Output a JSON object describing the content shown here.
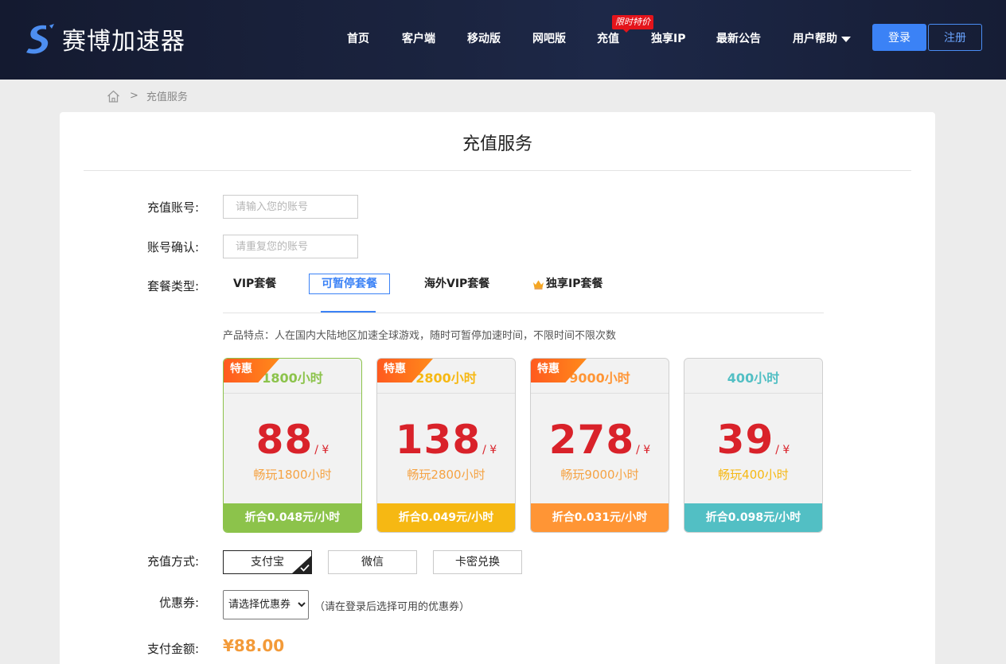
{
  "header": {
    "brand": "赛博加速器",
    "nav": [
      {
        "label": "首页"
      },
      {
        "label": "客户端"
      },
      {
        "label": "移动版"
      },
      {
        "label": "网吧版"
      },
      {
        "label": "充值"
      },
      {
        "label": "独享IP"
      },
      {
        "label": "最新公告"
      },
      {
        "label": "用户帮助"
      }
    ],
    "nav_badge": "限时特价",
    "login_label": "登录",
    "register_label": "注册"
  },
  "breadcrumb": {
    "separator": ">",
    "current": "充值服务"
  },
  "page_title": "充值服务",
  "form": {
    "account": {
      "label": "充值账号:",
      "placeholder": "请输入您的账号",
      "value": ""
    },
    "confirm": {
      "label": "账号确认:",
      "placeholder": "请重复您的账号",
      "value": ""
    },
    "package_type": {
      "label": "套餐类型:",
      "tabs": [
        {
          "label": "VIP套餐"
        },
        {
          "label": "可暂停套餐"
        },
        {
          "label": "海外VIP套餐"
        },
        {
          "label": "独享IP套餐"
        }
      ],
      "active": "可暂停套餐"
    },
    "feature_text": "产品特点：人在国内大陆地区加速全球游戏，随时可暂停加速时间，不限时间不限次数",
    "plans": [
      {
        "ribbon": "特惠",
        "hours": "1800小时",
        "price": "88",
        "unit": "/ ¥",
        "desc": "畅玩1800小时",
        "rate": "折合0.048元/小时",
        "accent": "#8cc34b",
        "head_color": "#8cc34b",
        "desc_color": "#f5a344",
        "selected": true
      },
      {
        "ribbon": "特惠",
        "hours": "2800小时",
        "price": "138",
        "unit": "/ ¥",
        "desc": "畅玩2800小时",
        "rate": "折合0.049元/小时",
        "accent": "#f6b813",
        "head_color": "#f6b813",
        "desc_color": "#f5a344",
        "selected": false
      },
      {
        "ribbon": "特惠",
        "hours": "9000小时",
        "price": "278",
        "unit": "/ ¥",
        "desc": "畅玩9000小时",
        "rate": "折合0.031元/小时",
        "accent": "#ff9535",
        "head_color": "#ff9535",
        "desc_color": "#f5a344",
        "selected": false
      },
      {
        "ribbon": "",
        "hours": "400小时",
        "price": "39",
        "unit": "/ ¥",
        "desc": "畅玩400小时",
        "rate": "折合0.098元/小时",
        "accent": "#52bfc4",
        "head_color": "#52bfc4",
        "desc_color": "#f6b813",
        "selected": false
      }
    ],
    "payment": {
      "label": "充值方式:",
      "options": [
        {
          "label": "支付宝"
        },
        {
          "label": "微信"
        },
        {
          "label": "卡密兑换"
        }
      ],
      "active": "支付宝"
    },
    "coupon": {
      "label": "优惠券:",
      "selected": "请选择优惠券",
      "hint": "（请在登录后选择可用的优惠券）"
    },
    "amount": {
      "label": "支付金额:",
      "value": "¥88.00"
    }
  },
  "colors": {
    "primary": "#3b82f6",
    "price_red": "#d9222a",
    "amount_orange": "#f39a38"
  }
}
